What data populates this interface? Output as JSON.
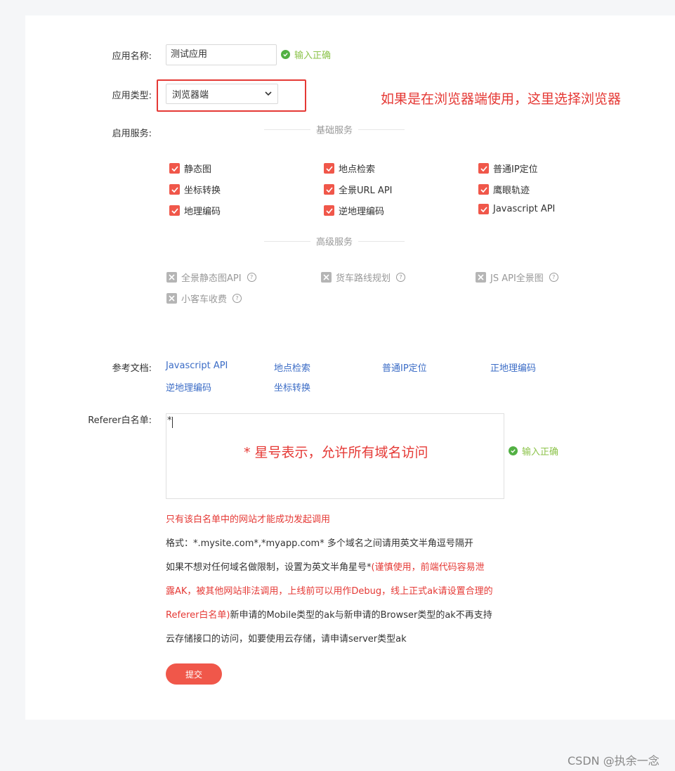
{
  "form": {
    "app_name": {
      "label": "应用名称:",
      "value": "测试应用",
      "status": "输入正确"
    },
    "app_type": {
      "label": "应用类型:",
      "value": "浏览器端",
      "annotation": "如果是在浏览器端使用，这里选择浏览器"
    },
    "services": {
      "label": "启用服务:",
      "basic_title": "基础服务",
      "basic_items": [
        "静态图",
        "地点检索",
        "普通IP定位",
        "坐标转换",
        "全景URL API",
        "鹰眼轨迹",
        "地理编码",
        "逆地理编码",
        "Javascript API"
      ],
      "advanced_title": "高级服务",
      "advanced_items": [
        "全景静态图API",
        "货车路线规划",
        "JS API全景图",
        "小客车收费"
      ]
    },
    "docs": {
      "label": "参考文档:",
      "links": [
        "Javascript API",
        "地点检索",
        "普通IP定位",
        "正地理编码",
        "逆地理编码",
        "坐标转换"
      ]
    },
    "referer": {
      "label": "Referer白名单:",
      "value": "*",
      "annotation": "* 星号表示，允许所有域名访问",
      "status": "输入正确",
      "notes": {
        "line1": "只有该白名单中的网站才能成功发起调用",
        "line2": "格式：*.mysite.com*,*myapp.com* 多个域名之间请用英文半角逗号隔开",
        "line3_normal": "如果不想对任何域名做限制，设置为英文半角星号*",
        "line3_red": "(谨慎使用，前端代码容易泄",
        "line4_red": "露AK，被其他网站非法调用，上线前可以用作Debug，线上正式ak请设置合理的",
        "line5_red": "Referer白名单)",
        "line5_normal": "新申请的Mobile类型的ak与新申请的Browser类型的ak不再支持",
        "line6": "云存储接口的访问，如要使用云存储，请申请server类型ak"
      }
    },
    "submit_label": "提交"
  },
  "watermark": "CSDN @执余一念",
  "colors": {
    "accent": "#f0574a",
    "success": "#8cc34a",
    "link": "#3b6cc6",
    "annotation": "#e53935"
  },
  "icons": {
    "check_circle": "check-circle-icon",
    "chevron": "chevron-down-icon",
    "checkbox": "checkbox-checked-icon",
    "disabled": "checkbox-disabled-icon",
    "help": "help-icon"
  }
}
